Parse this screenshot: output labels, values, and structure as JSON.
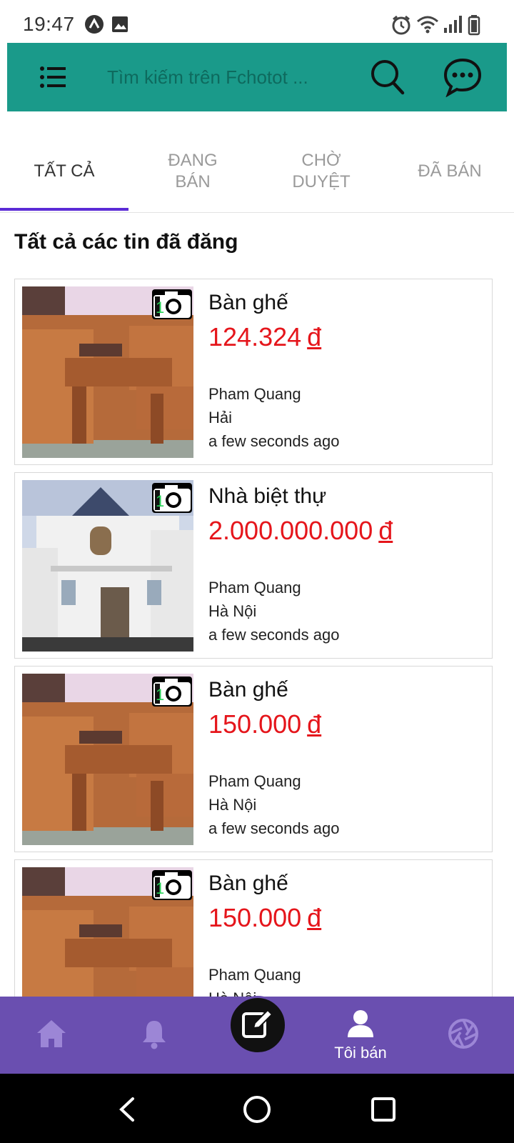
{
  "status_bar": {
    "time": "19:47",
    "icons": [
      "app-notification-icon",
      "image-icon",
      "alarm-icon",
      "wifi-icon",
      "signal-icon",
      "battery-icon"
    ]
  },
  "app_bar": {
    "color": "#1a9a8a",
    "search_placeholder": "Tìm kiếm trên Fchotot ...",
    "icons": [
      "menu-icon",
      "search-icon",
      "chat-icon"
    ]
  },
  "tabs": [
    {
      "label": "TẤT CẢ",
      "active": true
    },
    {
      "label": "ĐANG\nBÁN",
      "active": false
    },
    {
      "label": "CHỜ\nDUYỆT",
      "active": false
    },
    {
      "label": "ĐÃ BÁN",
      "active": false
    }
  ],
  "section_title": "Tất cả các tin đã đăng",
  "listings": [
    {
      "title": "Bàn ghế",
      "price": "124.324",
      "currency": "đ",
      "seller": "Pham Quang",
      "location": "Hải",
      "time": "a few seconds ago",
      "photo_count": "1",
      "image": "furniture-photo"
    },
    {
      "title": "Nhà biệt thự",
      "price": "2.000.000.000",
      "currency": "đ",
      "seller": "Pham Quang",
      "location": "Hà Nội",
      "time": "a few seconds ago",
      "photo_count": "1",
      "image": "villa-photo"
    },
    {
      "title": "Bàn ghế",
      "price": "150.000",
      "currency": "đ",
      "seller": "Pham Quang",
      "location": "Hà Nội",
      "time": "a few seconds ago",
      "photo_count": "1",
      "image": "furniture-photo"
    },
    {
      "title": "Bàn ghế",
      "price": "150.000",
      "currency": "đ",
      "seller": "Pham Quang",
      "location": "Hà Nội",
      "time": "",
      "photo_count": "1",
      "image": "furniture-photo"
    }
  ],
  "bottom_nav": {
    "color": "#6a4fb0",
    "items": [
      {
        "icon": "home-icon",
        "label": ""
      },
      {
        "icon": "bell-icon",
        "label": ""
      },
      {
        "icon": "edit-icon",
        "label": ""
      },
      {
        "icon": "user-icon",
        "label": "Tôi bán"
      },
      {
        "icon": "aperture-icon",
        "label": ""
      }
    ]
  },
  "system_nav": {
    "icons": [
      "back-icon",
      "home-circle-icon",
      "recents-icon"
    ]
  },
  "colors": {
    "price": "#e5151b",
    "tab_indicator": "#5b2bd6"
  }
}
